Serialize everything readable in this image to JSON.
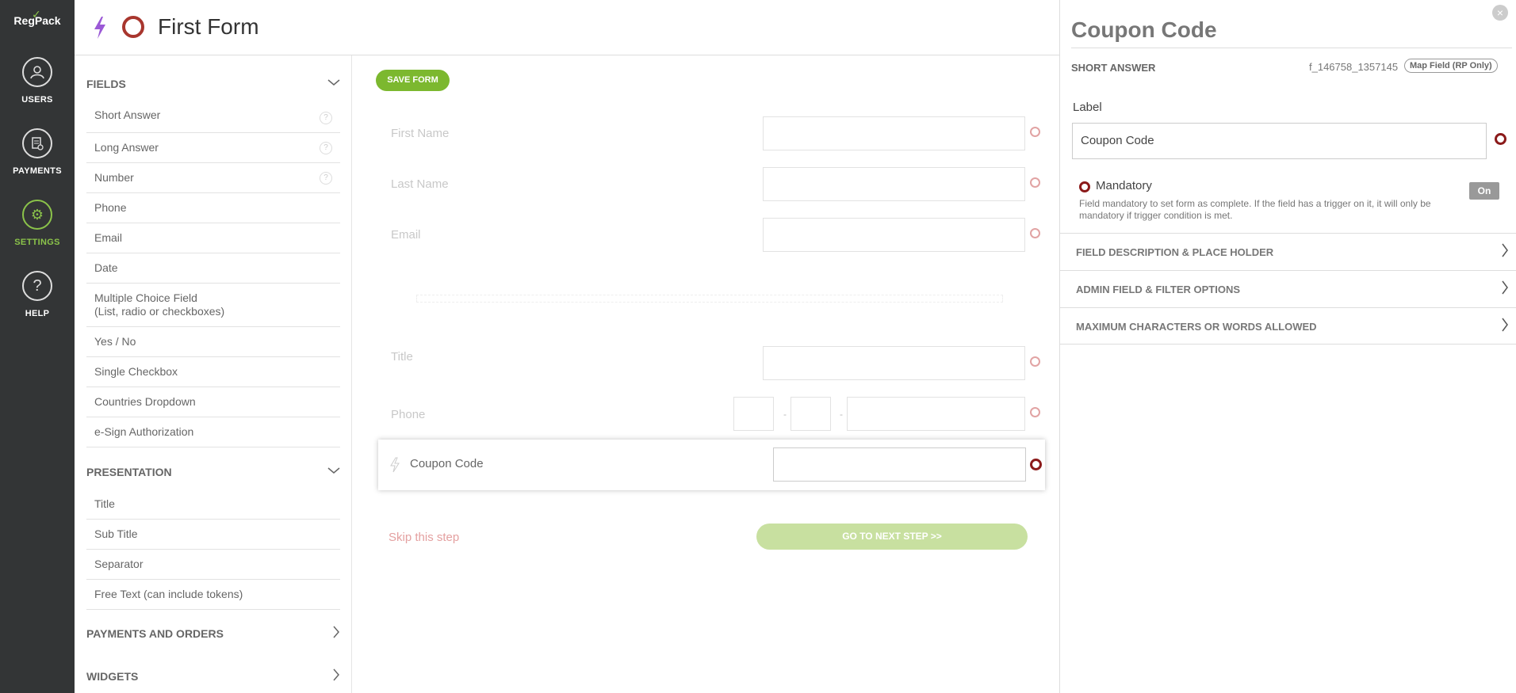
{
  "nav": {
    "logo": "RegPack",
    "items": [
      {
        "label": "USERS",
        "icon": "user-icon"
      },
      {
        "label": "PAYMENTS",
        "icon": "payments-icon"
      },
      {
        "label": "SETTINGS",
        "icon": "gear-icon"
      },
      {
        "label": "HELP",
        "icon": "help-icon"
      }
    ]
  },
  "header": {
    "title": "First Form"
  },
  "fields_panel": {
    "fields_heading": "FIELDS",
    "fields": [
      {
        "label": "Short Answer"
      },
      {
        "label": "Long Answer"
      },
      {
        "label": "Number"
      },
      {
        "label": "Phone"
      },
      {
        "label": "Email"
      },
      {
        "label": "Date"
      },
      {
        "label": "Multiple Choice Field",
        "sub": "(List, radio or checkboxes)"
      },
      {
        "label": "Yes / No"
      },
      {
        "label": "Single Checkbox"
      },
      {
        "label": "Countries Dropdown"
      },
      {
        "label": "e-Sign Authorization"
      }
    ],
    "presentation_heading": "PRESENTATION",
    "presentation": [
      {
        "label": "Title"
      },
      {
        "label": "Sub Title"
      },
      {
        "label": "Separator"
      },
      {
        "label": "Free Text (can include tokens)"
      }
    ],
    "payments_heading": "PAYMENTS AND ORDERS",
    "widgets_heading": "WIDGETS",
    "help_glyph": "?"
  },
  "canvas": {
    "save_label": "SAVE FORM",
    "rows": [
      {
        "label": "First Name"
      },
      {
        "label": "Last Name"
      },
      {
        "label": "Email"
      },
      {
        "label": "Title"
      },
      {
        "label": "Phone"
      }
    ],
    "phone_dash": "-",
    "coupon_label": "Coupon Code",
    "skip_label": "Skip this step",
    "next_label": "GO TO NEXT STEP >>"
  },
  "side": {
    "title": "Coupon Code",
    "type": "SHORT ANSWER",
    "field_id": "f_146758_1357145",
    "map_field": "Map Field (RP Only)",
    "label_caption": "Label",
    "label_value": "Coupon Code",
    "mandatory_label": "Mandatory",
    "mandatory_desc": "Field mandatory to set form as complete. If the field has a trigger on it, it will only be mandatory if trigger condition is met.",
    "toggle": "On",
    "sections": [
      {
        "label": "FIELD DESCRIPTION & PLACE HOLDER"
      },
      {
        "label": "ADMIN FIELD & FILTER OPTIONS"
      },
      {
        "label": "MAXIMUM CHARACTERS OR WORDS ALLOWED"
      }
    ],
    "close_glyph": "×"
  },
  "colors": {
    "nav_bg": "#333536",
    "accent_green": "#7cb82f",
    "required_red": "#8b1a1a",
    "bolt_purple": "#9b59d6"
  }
}
